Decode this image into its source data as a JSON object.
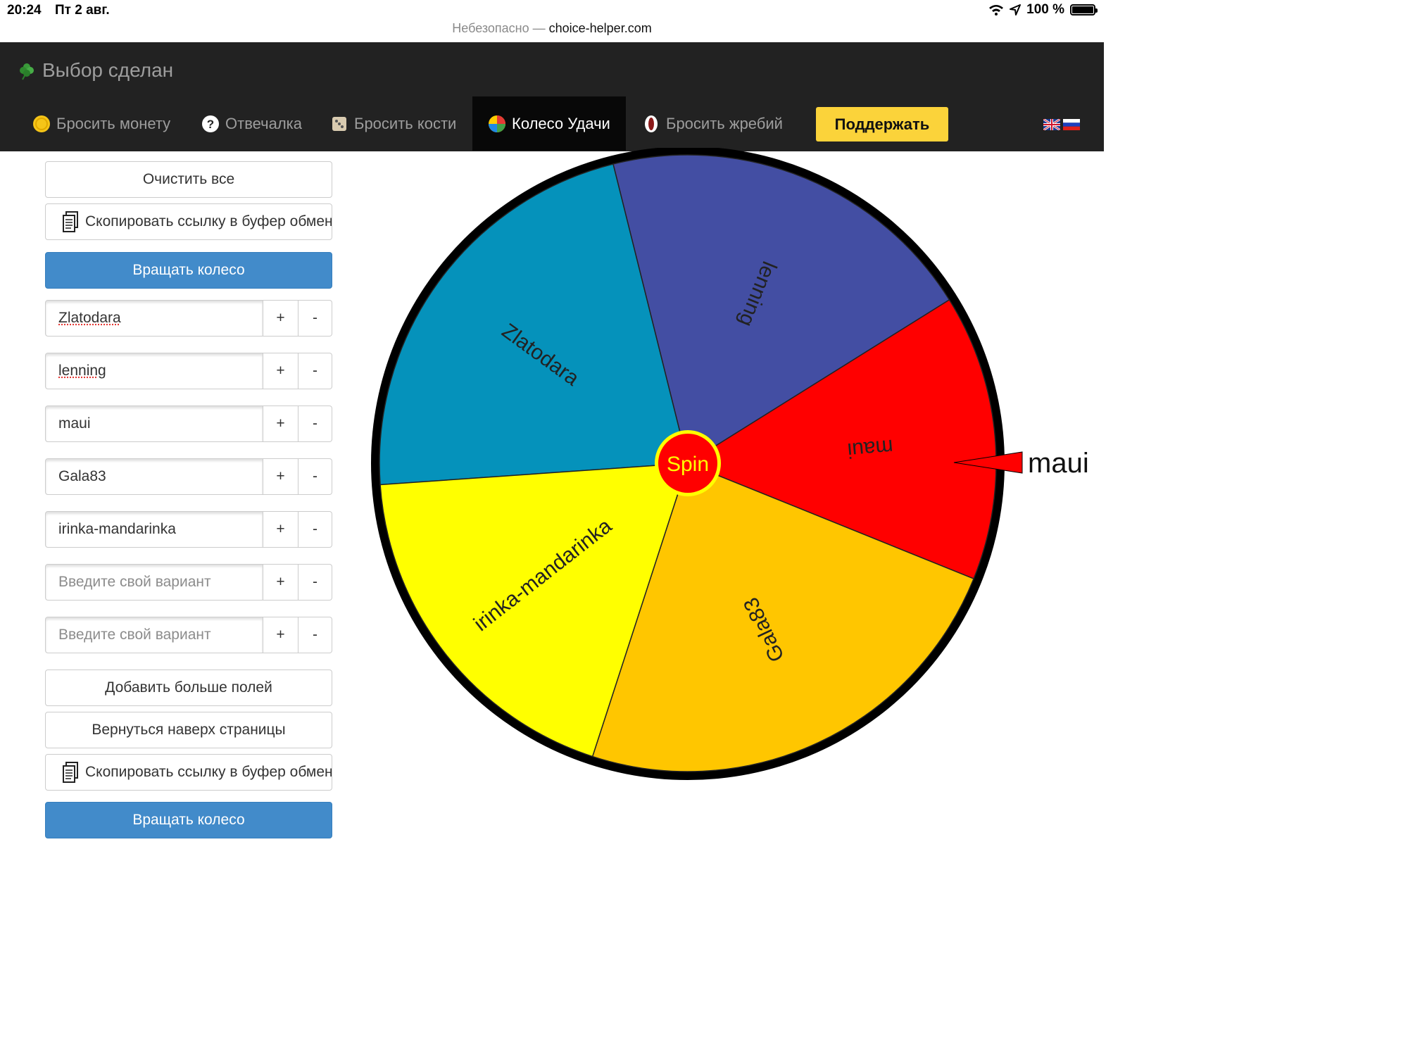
{
  "status_bar": {
    "time": "20:24",
    "date": "Пт 2 авг.",
    "battery": "100 %"
  },
  "browser": {
    "insecure_label": "Небезопасно —",
    "host": "choice-helper.com"
  },
  "brand": {
    "title": "Выбор сделан",
    "icon": "clover-icon"
  },
  "nav": {
    "items": [
      {
        "label": "Бросить монету",
        "icon": "coin-icon"
      },
      {
        "label": "Отвечалка",
        "icon": "question-icon"
      },
      {
        "label": "Бросить кости",
        "icon": "dice-icon"
      },
      {
        "label": "Колесо Удачи",
        "icon": "wheel-icon",
        "active": true
      },
      {
        "label": "Бросить жребий",
        "icon": "lot-icon"
      }
    ],
    "support_label": "Поддержать",
    "languages": [
      "en-flag-icon",
      "ru-flag-icon"
    ]
  },
  "panel": {
    "clear_label": "Очистить все",
    "copy_label": "Скопировать ссылку в буфер обмена",
    "spin_label": "Вращать колесо",
    "add_fields_label": "Добавить больше полей",
    "back_top_label": "Вернуться наверх страницы",
    "plus": "+",
    "minus": "-",
    "placeholder": "Введите свой вариант",
    "entries": [
      "Zlatodara",
      "lenning",
      "maui",
      "Gala83",
      "irinka-mandarinka",
      "",
      ""
    ]
  },
  "wheel": {
    "center_label": "Spin",
    "result": "maui",
    "segments": [
      {
        "label": "Zlatodara",
        "color": "#0592bb"
      },
      {
        "label": "lenning",
        "color": "#434ea3"
      },
      {
        "label": "maui",
        "color": "#ff0000"
      },
      {
        "label": "Gala83",
        "color": "#ffc600"
      },
      {
        "label": "irinka-mandarinka",
        "color": "#ffff00"
      }
    ]
  }
}
